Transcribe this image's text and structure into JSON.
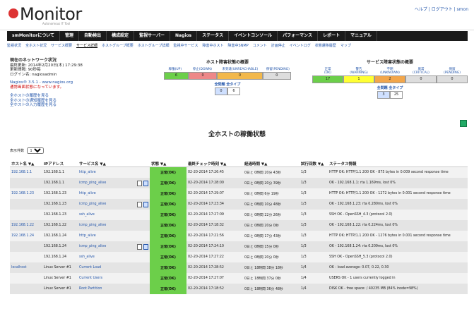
{
  "header": {
    "logo_text": "Monitor",
    "logo_sub": "Autonomous IT Tool",
    "top_links": "ヘルプ | ログアウト | smon"
  },
  "menu": [
    "smMonitorについて",
    "管理",
    "自動検出",
    "構成設定",
    "監視サーバー",
    "Nagios",
    "ステータス",
    "イベントコンソール",
    "パフォーマンス",
    "レポート",
    "マニュアル"
  ],
  "subnav": {
    "items": [
      "監視状況",
      "全ホスト状況",
      "サービス概要",
      "サービス詳細",
      "ホストグループ概要",
      "ホストグループ詳細",
      "監視中サービス",
      "障害中ホスト",
      "障害中SNMP",
      "コメント",
      "計画停止",
      "イベントログ",
      "状態遷移履歴",
      "マップ"
    ],
    "selected_index": 3
  },
  "status": {
    "title": "現在のネットワーク状況",
    "lines": [
      "最終更新: 2014年2月20日(木) 17:29:38",
      "更新間隔: 90秒毎",
      "ログイン名: nagiosadmin"
    ],
    "version": "Nagios® 3.5.1 - www.nagios.org",
    "error": "通常画面状態になっています。",
    "links": [
      "全ホストの履歴を見る",
      "全ホストの通知履歴を見る",
      "全ホストの入力履歴を見る"
    ]
  },
  "host_totals": {
    "title": "ホスト障害状態の概要",
    "headers": [
      "稼働(UP)",
      "停止(DOWN)",
      "未到達(UNREACHABLE)",
      "保留(PENDING)"
    ],
    "values": [
      "6",
      "0",
      "0",
      "0"
    ],
    "colors": [
      "#6ccf4a",
      "#ee8888",
      "#f2b84b",
      "#dddddd"
    ],
    "sub_title": "全問題  全タイプ",
    "sub_values": [
      "0",
      "6"
    ]
  },
  "svc_totals": {
    "title": "サービス障害状態の概要",
    "headers": [
      "正常",
      "警告",
      "不明",
      "異常",
      "保留"
    ],
    "header_sub": [
      "(OK)",
      "(WARNING)",
      "(UNKNOWN)",
      "(CRITICAL)",
      "(PENDING)"
    ],
    "values": [
      "17",
      "1",
      "2",
      "0",
      "0"
    ],
    "colors": [
      "#6ccf4a",
      "#ffff33",
      "#f2a64b",
      "#dddddd",
      "#dddddd"
    ],
    "sub_title": "全問題  全タイプ",
    "sub_values": [
      "3",
      "25"
    ]
  },
  "page_title": "全ホストの稼働状態",
  "limit": {
    "label": "表示件数",
    "value": "100"
  },
  "table": {
    "headers": [
      "ホスト名 ▼▲",
      "IPアドレス",
      "サービス名 ▼▲",
      "",
      "状態 ▼▲",
      "最終チェック時刻 ▼▲",
      "経過時間 ▼▲",
      "試行回数 ▼▲",
      "ステータス情報"
    ],
    "rows": [
      {
        "host": "192.168.1.1",
        "ip": "192.168.1.1",
        "svc": "http_alive",
        "icons": 0,
        "state": "正常(OK)",
        "check": "02-20-2014 17:26:45",
        "dur": "0日と 0時間 20分 43秒",
        "att": "1/3",
        "info": "HTTP OK: HTTP/1.1 200 OK - 875 bytes in 0.009 second response time"
      },
      {
        "host": "",
        "ip": "192.168.1.1",
        "svc": "icmp_ping_alive",
        "icons": 2,
        "state": "正常(OK)",
        "check": "02-20-2014 17:28:00",
        "dur": "0日と 0時間 20分 39秒",
        "att": "1/3",
        "info": "OK - 192.168.1.1: rta 1.169ms, lost 0%"
      },
      {
        "host": "192.168.1.23",
        "ip": "192.168.1.23",
        "svc": "http_alive",
        "icons": 0,
        "state": "正常(OK)",
        "check": "02-20-2014 17:29:07",
        "dur": "0日と 0時間 6分 19秒",
        "att": "1/3",
        "info": "HTTP OK: HTTP/1.1 200 OK - 1272 bytes in 0.001 second response time"
      },
      {
        "host": "",
        "ip": "192.168.1.23",
        "svc": "icmp_ping_alive",
        "icons": 2,
        "state": "正常(OK)",
        "check": "02-20-2014 17:23:34",
        "dur": "0日と 0時間 10分 48秒",
        "att": "1/3",
        "info": "OK - 192.168.1.23: rta 0.280ms, lost 0%"
      },
      {
        "host": "",
        "ip": "192.168.1.23",
        "svc": "ssh_alive",
        "icons": 0,
        "state": "正常(OK)",
        "check": "02-20-2014 17:27:09",
        "dur": "0日と 0時間 22分 26秒",
        "att": "1/3",
        "info": "SSH OK - OpenSSH_4.3 (protocol 2.0)"
      },
      {
        "host": "192.168.1.22",
        "ip": "192.168.1.22",
        "svc": "icmp_ping_alive",
        "icons": 0,
        "state": "正常(OK)",
        "check": "02-20-2014 17:18:32",
        "dur": "0日と 0時間 20分 0秒",
        "att": "1/3",
        "info": "OK - 192.168.1.22: rta 0.224ms, lost 0%"
      },
      {
        "host": "192.168.1.24",
        "ip": "192.168.1.24",
        "svc": "http_alive",
        "icons": 0,
        "state": "正常(OK)",
        "check": "02-20-2014 17:21:56",
        "dur": "0日と 0時間 17分 43秒",
        "att": "1/3",
        "info": "HTTP OK: HTTP/1.1 200 OK - 1276 bytes in 0.001 second response time"
      },
      {
        "host": "",
        "ip": "192.168.1.24",
        "svc": "icmp_ping_alive",
        "icons": 2,
        "state": "正常(OK)",
        "check": "02-20-2014 17:24:10",
        "dur": "0日と 0時間 15分 0秒",
        "att": "1/3",
        "info": "OK - 192.168.1.24: rta 0.209ms, lost 0%"
      },
      {
        "host": "",
        "ip": "192.168.1.24",
        "svc": "ssh_alive",
        "icons": 0,
        "state": "正常(OK)",
        "check": "02-20-2014 17:27:22",
        "dur": "0日と 0時間 20分 0秒",
        "att": "1/3",
        "info": "SSH OK - OpenSSH_5.3 (protocol 2.0)"
      },
      {
        "host": "localhost",
        "ip": "Linux Server #1",
        "svc": "Current Load",
        "icons": 0,
        "state": "正常(OK)",
        "check": "02-20-2014 17:28:52",
        "dur": "0日と 18時間 38分 18秒",
        "att": "1/4",
        "info": "OK - load average: 0.07, 0.22, 0.30"
      },
      {
        "host": "",
        "ip": "Linux Server #1",
        "svc": "Current Users",
        "icons": 0,
        "state": "正常(OK)",
        "check": "02-20-2014 17:27:07",
        "dur": "0日と 18時間 37分 0秒",
        "att": "1/4",
        "info": "USERS OK - 1 users currently logged in"
      },
      {
        "host": "",
        "ip": "Linux Server #1",
        "svc": "Root Partition",
        "icons": 0,
        "state": "正常(OK)",
        "check": "02-20-2014 17:18:52",
        "dur": "0日と 18時間 36分 48秒",
        "att": "1/4",
        "info": "DISK OK - free space: / 40235 MB (84% inode=98%)"
      }
    ]
  }
}
